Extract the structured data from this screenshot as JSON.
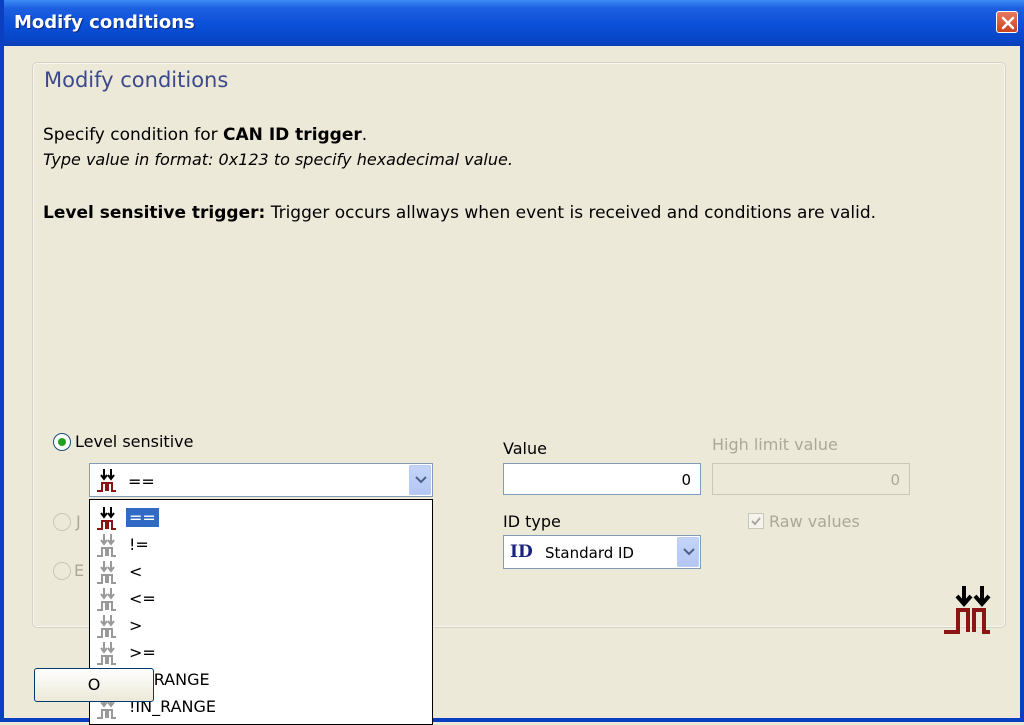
{
  "window": {
    "title": "Modify conditions"
  },
  "heading": "Modify conditions",
  "description": {
    "line1_prefix": "Specify condition for ",
    "line1_bold": "CAN ID trigger",
    "line1_suffix": ".",
    "line2": "Type value in format: 0x123 to specify hexadecimal value.",
    "line3_bold": "Level sensitive trigger:",
    "line3_rest": " Trigger occurs allways when event is received and conditions are valid."
  },
  "trigger_mode": {
    "level_sensitive_label": "Level sensitive",
    "hidden_option_fragment_1": "J",
    "hidden_option_fragment_2": "E"
  },
  "operator": {
    "selected": "==",
    "options": [
      "==",
      "!=",
      "<",
      "<=",
      ">",
      ">=",
      "IN_RANGE",
      "!IN_RANGE"
    ]
  },
  "value": {
    "label": "Value",
    "value": "0"
  },
  "high_limit": {
    "label": "High limit value",
    "value": "0"
  },
  "id_type": {
    "label": "ID type",
    "badge": "ID",
    "selected": "Standard ID"
  },
  "raw_values": {
    "label": "Raw values",
    "checked": true
  },
  "ok_button": {
    "label": "O"
  },
  "colors": {
    "titlebar": "#0a4fd8",
    "heading": "#3c4a8c",
    "selection": "#316ac5",
    "trigger_icon": "#8b1414"
  }
}
